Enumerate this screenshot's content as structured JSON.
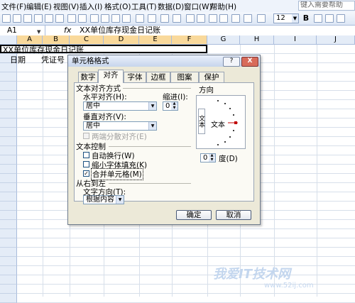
{
  "menu": {
    "items": [
      "文件(F)",
      "编辑(E)",
      "视图(V)",
      "插入(I)",
      "格式(O)",
      "工具(T)",
      "数据(D)",
      "窗口(W)",
      "帮助(H)"
    ],
    "help_placeholder": "键入需要帮助"
  },
  "toolbar": {
    "font_size": "12",
    "bold_label": "B"
  },
  "formula_bar": {
    "name_box": "A1",
    "fx_label": "fx",
    "content": "XX单位库存现金日记账"
  },
  "sheet": {
    "columns": [
      "A",
      "B",
      "C",
      "D",
      "E",
      "F",
      "G",
      "H",
      "I",
      "J"
    ],
    "a1_value": "XX单位库存现金日记账",
    "a2_value": "日期",
    "b2_value": "凭证号"
  },
  "dialog": {
    "title": "单元格格式",
    "help_button": "?",
    "close_button": "X",
    "tabs": [
      "数字",
      "对齐",
      "字体",
      "边框",
      "图案",
      "保护"
    ],
    "active_tab": "对齐",
    "text_align_section": "文本对齐方式",
    "horizontal_label": "水平对齐(H):",
    "horizontal_value": "居中",
    "indent_label": "缩进(I):",
    "indent_value": "0",
    "vertical_label": "垂直对齐(V):",
    "vertical_value": "居中",
    "justify_distributed": "两端分散对齐(E)",
    "text_control_section": "文本控制",
    "wrap_text": "自动换行(W)",
    "shrink_to_fit": "缩小字体填充(K)",
    "merge_cells": "合并单元格(M)",
    "merge_checked": true,
    "rtl_section": "从右到左",
    "direction_label": "文字方向(T):",
    "direction_value": "根据内容",
    "orientation_section": "方向",
    "orientation_vertical_text": "文本",
    "orientation_text": "文本",
    "degree_value": "0",
    "degree_label": "度(D)",
    "ok_button": "确定",
    "cancel_button": "取消"
  },
  "watermark": {
    "text": "我爱IT技术网",
    "url": "www.52ij.com"
  }
}
